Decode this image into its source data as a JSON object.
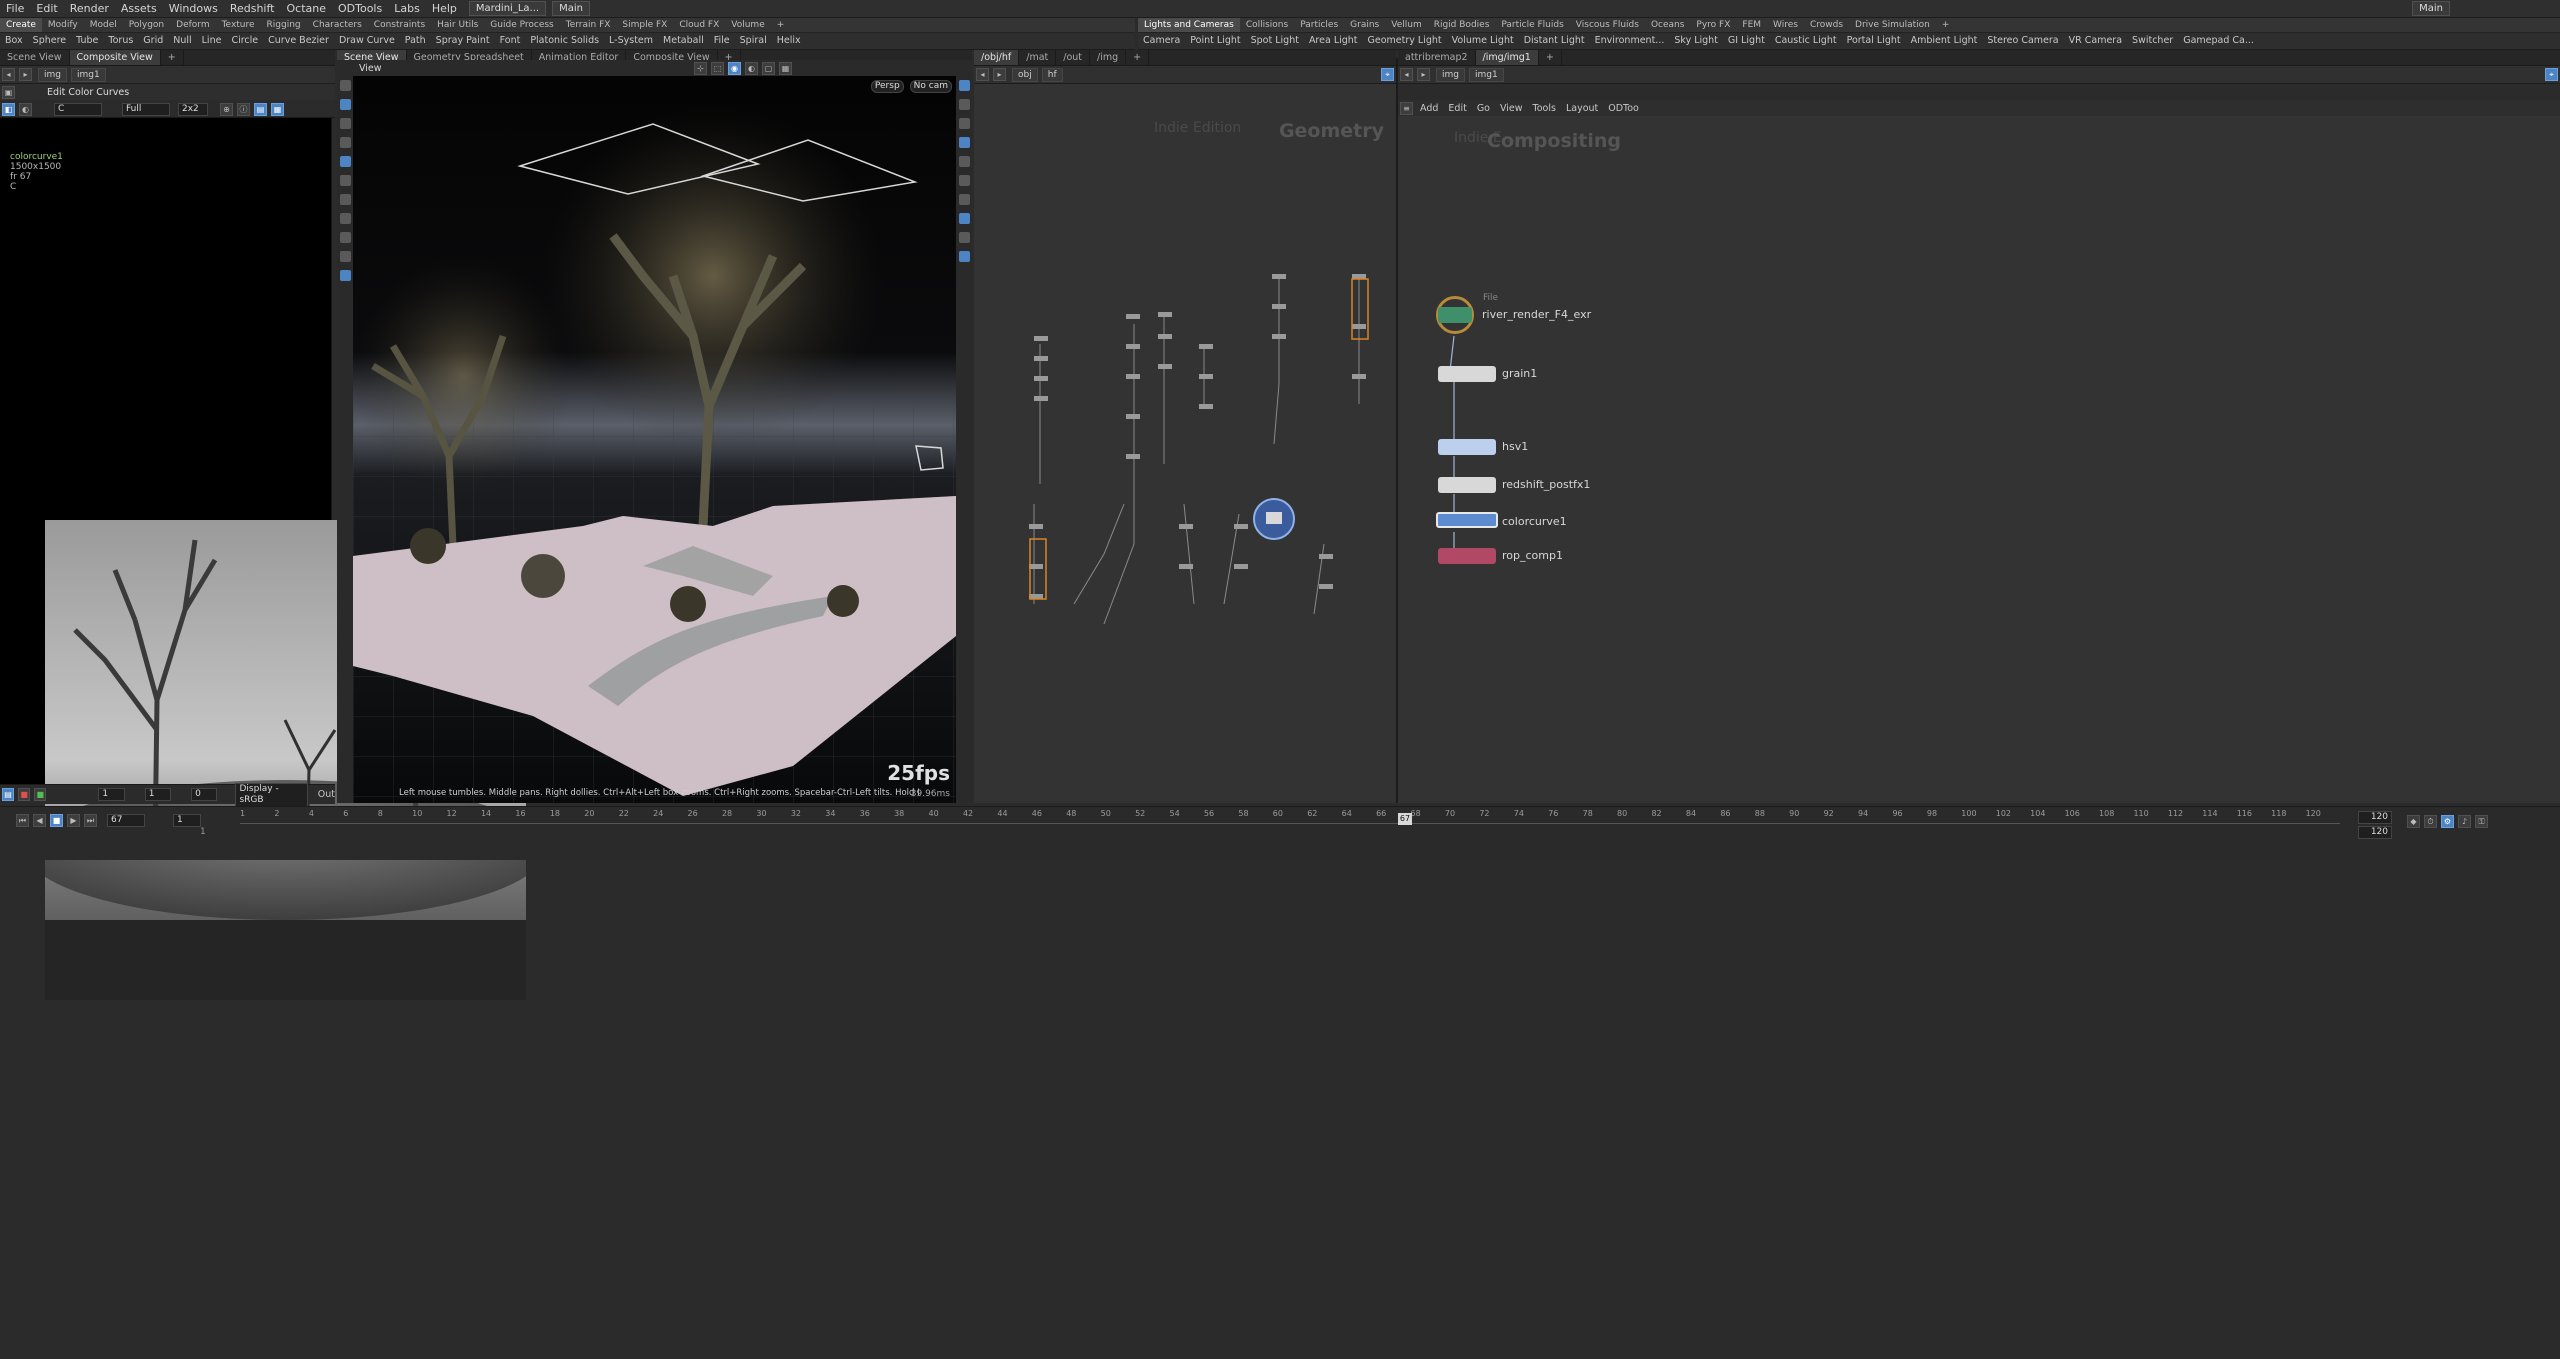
{
  "menubar": {
    "items": [
      "File",
      "Edit",
      "Render",
      "Assets",
      "Windows",
      "Redshift",
      "Octane",
      "ODTools",
      "Labs",
      "Help"
    ],
    "scene_file": "Mardini_La...",
    "desktop": "Main",
    "desktop_right": "Main"
  },
  "shelf_left": {
    "tabs": [
      "Create",
      "Modify",
      "Model",
      "Polygon",
      "Deform",
      "Texture",
      "Rigging",
      "Characters",
      "Constraints",
      "Hair Utils",
      "Guide Process",
      "Terrain FX",
      "Simple FX",
      "Cloud FX",
      "Volume"
    ],
    "active": "Create",
    "tools": [
      "Box",
      "Sphere",
      "Tube",
      "Torus",
      "Grid",
      "Null",
      "Line",
      "Circle",
      "Curve Bezier",
      "Draw Curve",
      "Path",
      "Spray Paint",
      "Font",
      "Platonic Solids",
      "L-System",
      "Metaball",
      "File",
      "Spiral",
      "Helix"
    ]
  },
  "shelf_right": {
    "tabs": [
      "Lights and Cameras",
      "Collisions",
      "Particles",
      "Grains",
      "Vellum",
      "Rigid Bodies",
      "Particle Fluids",
      "Viscous Fluids",
      "Oceans",
      "Pyro FX",
      "FEM",
      "Wires",
      "Crowds",
      "Drive Simulation"
    ],
    "active": "Lights and Cameras",
    "tools": [
      "Camera",
      "Point Light",
      "Spot Light",
      "Area Light",
      "Geometry Light",
      "Volume Light",
      "Distant Light",
      "Environment...",
      "Sky Light",
      "GI Light",
      "Caustic Light",
      "Portal Light",
      "Ambient Light",
      "Stereo Camera",
      "VR Camera",
      "Switcher",
      "Gamepad Ca..."
    ]
  },
  "pane_left": {
    "tabs": [
      "Scene View",
      "Composite View"
    ],
    "active": "Composite View",
    "path": [
      "img",
      "img1"
    ],
    "tool_label": "Edit Color Curves",
    "channel": "C",
    "resolution_mode": "Full",
    "split": "2x2",
    "info": [
      "colorcurve1",
      "1500x1500",
      "fr 67",
      "C"
    ],
    "display": "Display - sRGB",
    "out_label": "Out",
    "frame_field": "1",
    "stack_field": "0",
    "bottom_field": "1"
  },
  "pane_center": {
    "tabs": [
      "Scene View",
      "Geometry Spreadsheet",
      "Animation Editor",
      "Composite View"
    ],
    "active": "Scene View",
    "path": [
      "obj",
      "hf"
    ],
    "view_label": "View",
    "persp": "Persp",
    "cam": "No cam",
    "fps": "25fps",
    "ms": "39.96ms",
    "hint": "Left mouse tumbles. Middle pans. Right dollies. Ctrl+Alt+Left box-zooms. Ctrl+Right zooms. Spacebar-Ctrl-Left tilts. Hold L for alternate tumble, dolly, and zoom.     M or Alt+M for First Person Navigation.",
    "ind": "Ind"
  },
  "pane_obj": {
    "tabs": [
      "/obj/hf",
      "/mat",
      "/out",
      "/img"
    ],
    "active": "/obj/hf",
    "path": [
      "obj",
      "hf"
    ],
    "watermark": "Indie Edition",
    "context": "Geometry"
  },
  "pane_img": {
    "tabs": [
      "attribremap2",
      "/img/img1"
    ],
    "active": "/img/img1",
    "path": [
      "img",
      "img1"
    ],
    "menu": [
      "Add",
      "Edit",
      "Go",
      "View",
      "Tools",
      "Layout",
      "ODToo"
    ],
    "watermark": "Indie E...",
    "context": "Compositing",
    "file_label": "File",
    "nodes": [
      "river_render_F4_exr",
      "grain1",
      "hsv1",
      "redshift_postfx1",
      "colorcurve1",
      "rop_comp1"
    ]
  },
  "timeline": {
    "current_frame": "67",
    "start": "1",
    "start2": "1",
    "end": "120",
    "end2": "120",
    "ticks": [
      "1",
      "2",
      "4",
      "6",
      "8",
      "10",
      "12",
      "14",
      "16",
      "18",
      "20",
      "22",
      "24",
      "26",
      "28",
      "30",
      "32",
      "34",
      "36",
      "38",
      "40",
      "42",
      "44",
      "46",
      "48",
      "50",
      "52",
      "54",
      "56",
      "58",
      "60",
      "62",
      "64",
      "66",
      "68",
      "70",
      "72",
      "74",
      "76",
      "78",
      "80",
      "82",
      "84",
      "86",
      "88",
      "90",
      "92",
      "94",
      "96",
      "98",
      "100",
      "102",
      "104",
      "106",
      "108",
      "110",
      "112",
      "114",
      "116",
      "118",
      "120"
    ],
    "marker": "67"
  },
  "colors": {
    "accent": "#4d84c4",
    "node_file": "#3f8f6b",
    "node_rop": "#b04866",
    "node_colorcurve": "#5c8ccf"
  }
}
